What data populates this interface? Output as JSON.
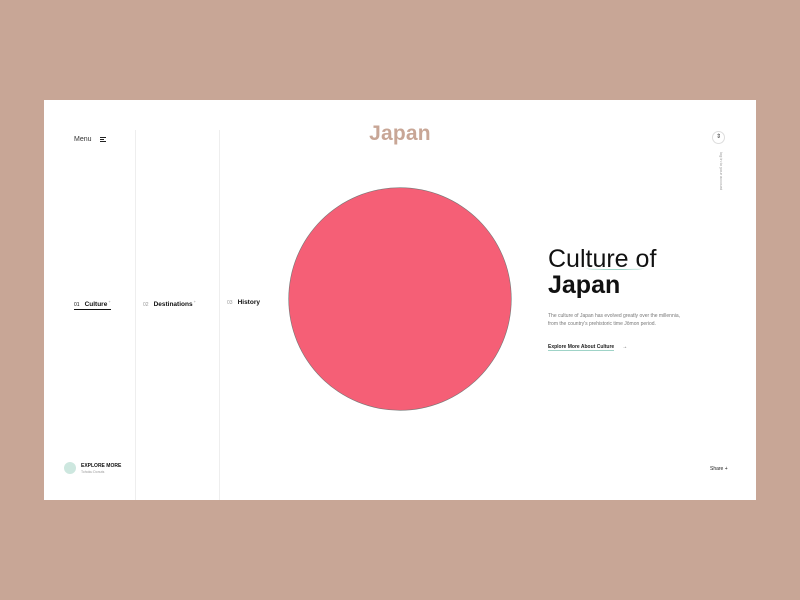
{
  "header": {
    "menu_label": "Menu",
    "title": "Japan",
    "top_button_glyph": "⇕",
    "vertical_text": "log in to your account"
  },
  "nav": {
    "items": [
      {
        "num": "01",
        "label": "Culture",
        "sup": "+"
      },
      {
        "num": "02",
        "label": "Destinations",
        "sup": "+"
      },
      {
        "num": "03",
        "label": "History",
        "sup": ""
      }
    ]
  },
  "hero": {
    "heading_light": "Culture of",
    "heading_bold": "Japan",
    "description": "The culture of Japan has evolved greatly over the millennia, from the country's prehistoric time Jōmon period.",
    "link_label": "Explore More About Culture",
    "link_arrow": "→"
  },
  "footer": {
    "explore_title": "EXPLORE MORE",
    "explore_sub": "Tohoku Donuts",
    "share_label": "Share +"
  },
  "colors": {
    "page_background": "#c8a696",
    "card_background": "#ffffff",
    "title": "#c8a696",
    "sun_circle": "#f55f76",
    "accent_mint": "#9fd3c7"
  }
}
